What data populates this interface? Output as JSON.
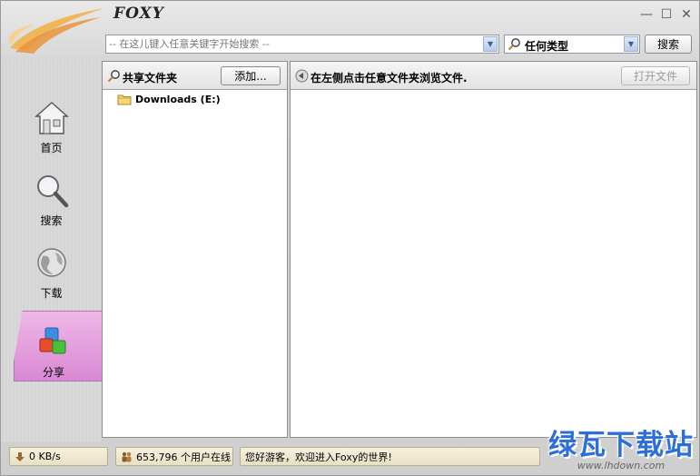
{
  "app": {
    "title": "FOXY",
    "window_controls": {
      "minimize": "—",
      "maximize": "☐",
      "close": "✕"
    }
  },
  "search": {
    "placeholder": "-- 在这儿键入任意关键字开始搜索 --",
    "type_value": "任何类型",
    "button_label": "搜索"
  },
  "nav": {
    "items": [
      {
        "label": "首页",
        "icon": "home-icon"
      },
      {
        "label": "搜索",
        "icon": "magnifier-icon"
      },
      {
        "label": "下载",
        "icon": "globe-icon"
      },
      {
        "label": "分享",
        "icon": "cubes-icon",
        "active": true
      }
    ],
    "active_color": "#e3a0dc"
  },
  "left_panel": {
    "title": "共享文件夹",
    "add_button": "添加...",
    "folders": [
      {
        "label": "Downloads (E:)",
        "icon": "folder-icon"
      }
    ]
  },
  "right_panel": {
    "title": "在左侧点击任意文件夹浏览文件.",
    "open_button": "打开文件"
  },
  "status": {
    "speed": "0 KB/s",
    "users": "653,796 个用户在线",
    "message": "您好游客，欢迎进入Foxy的世界!"
  },
  "watermark": {
    "main": "绿瓦下载站",
    "sub": "www.lhdown.com"
  }
}
